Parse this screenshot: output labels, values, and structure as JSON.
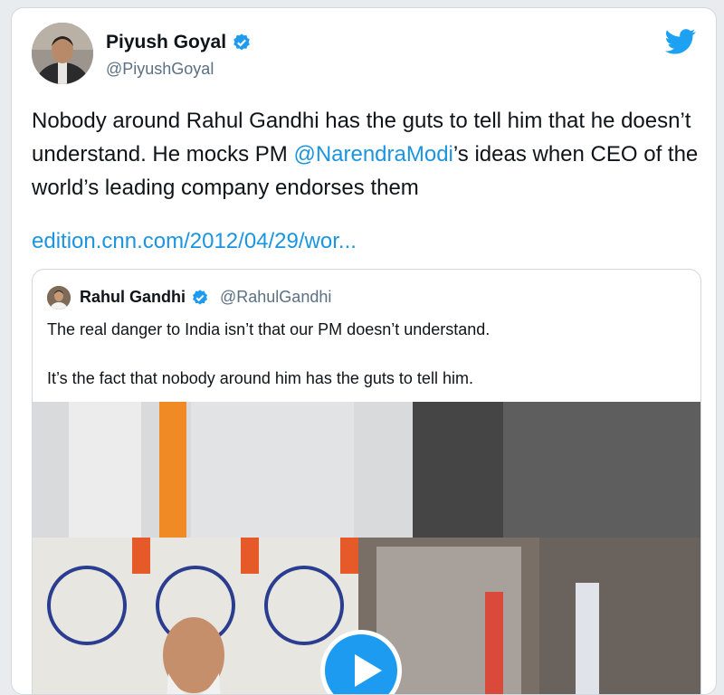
{
  "tweet": {
    "author_name": "Piyush Goyal",
    "author_handle": "@PiyushGoyal",
    "text_before_mention": "Nobody around Rahul Gandhi has the guts to tell him that he doesn’t understand. He mocks PM ",
    "mention": "@NarendraModi",
    "text_after_mention": "’s ideas when CEO of the world’s leading company endorses them",
    "link": "edition.cnn.com/2012/04/29/wor..."
  },
  "quoted_tweet": {
    "author_name": "Rahul Gandhi",
    "author_handle": "@RahulGandhi",
    "line1": "The real danger to India isn’t that our PM doesn’t understand.",
    "line2": "It’s the fact that nobody around him has the guts to tell him."
  },
  "icons": {
    "verified": "verified-badge-icon",
    "brand": "twitter-bird-icon",
    "play": "play-icon"
  },
  "colors": {
    "link": "#1b95e0",
    "verified": "#1d9bf0",
    "brand": "#1da1f2",
    "secondary_text": "#5b7083"
  }
}
